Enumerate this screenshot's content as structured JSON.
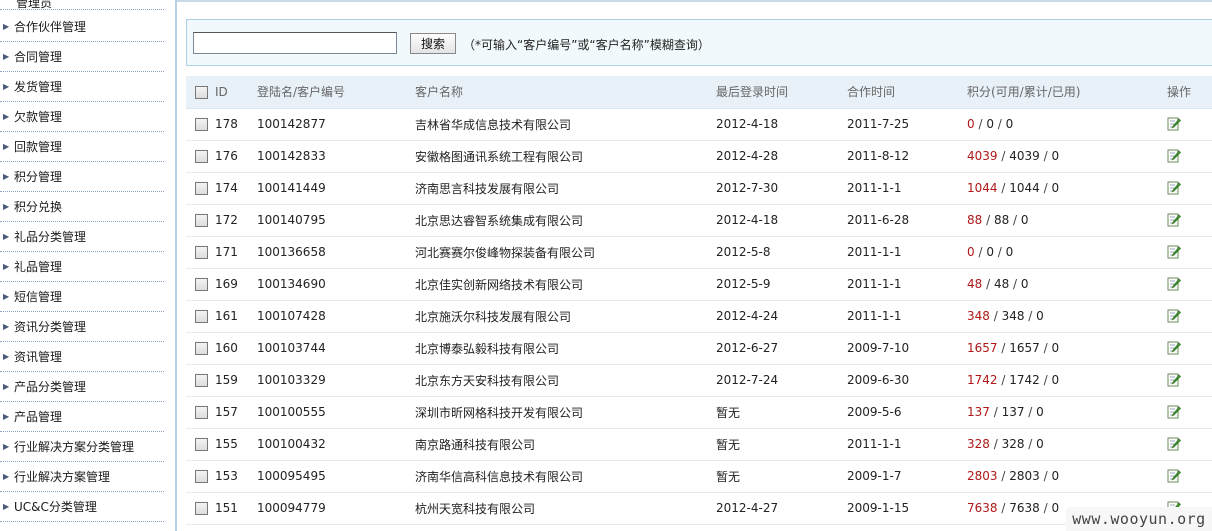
{
  "sidebar": {
    "partial_top_label": "管理员",
    "items": [
      {
        "label": "合作伙伴管理"
      },
      {
        "label": "合同管理"
      },
      {
        "label": "发货管理"
      },
      {
        "label": "欠款管理"
      },
      {
        "label": "回款管理"
      },
      {
        "label": "积分管理"
      },
      {
        "label": "积分兑换"
      },
      {
        "label": "礼品分类管理"
      },
      {
        "label": "礼品管理"
      },
      {
        "label": "短信管理"
      },
      {
        "label": "资讯分类管理"
      },
      {
        "label": "资讯管理"
      },
      {
        "label": "产品分类管理"
      },
      {
        "label": "产品管理"
      },
      {
        "label": "行业解决方案分类管理"
      },
      {
        "label": "行业解决方案管理"
      },
      {
        "label": "UC&C分类管理"
      }
    ]
  },
  "search": {
    "value": "",
    "button_label": "搜索",
    "hint": "（*可输入“客户编号”或“客户名称”模糊查询）"
  },
  "table": {
    "headers": {
      "id": "ID",
      "login": "登陆名/客户编号",
      "name": "客户名称",
      "last_login": "最后登录时间",
      "coop_time": "合作时间",
      "points": "积分(可用/累计/已用)",
      "ops": "操作"
    },
    "rows": [
      {
        "id": "178",
        "login": "100142877",
        "name": "吉林省华成信息技术有限公司",
        "last_login": "2012-4-18",
        "coop_time": "2011-7-25",
        "avail": "0",
        "total": "0",
        "used": "0"
      },
      {
        "id": "176",
        "login": "100142833",
        "name": "安徽格图通讯系统工程有限公司",
        "last_login": "2012-4-28",
        "coop_time": "2011-8-12",
        "avail": "4039",
        "total": "4039",
        "used": "0"
      },
      {
        "id": "174",
        "login": "100141449",
        "name": "济南思言科技发展有限公司",
        "last_login": "2012-7-30",
        "coop_time": "2011-1-1",
        "avail": "1044",
        "total": "1044",
        "used": "0"
      },
      {
        "id": "172",
        "login": "100140795",
        "name": "北京思达睿智系统集成有限公司",
        "last_login": "2012-4-18",
        "coop_time": "2011-6-28",
        "avail": "88",
        "total": "88",
        "used": "0"
      },
      {
        "id": "171",
        "login": "100136658",
        "name": "河北赛赛尔俊峰物探装备有限公司",
        "last_login": "2012-5-8",
        "coop_time": "2011-1-1",
        "avail": "0",
        "total": "0",
        "used": "0"
      },
      {
        "id": "169",
        "login": "100134690",
        "name": "北京佳实创新网络技术有限公司",
        "last_login": "2012-5-9",
        "coop_time": "2011-1-1",
        "avail": "48",
        "total": "48",
        "used": "0"
      },
      {
        "id": "161",
        "login": "100107428",
        "name": "北京施沃尔科技发展有限公司",
        "last_login": "2012-4-24",
        "coop_time": "2011-1-1",
        "avail": "348",
        "total": "348",
        "used": "0"
      },
      {
        "id": "160",
        "login": "100103744",
        "name": "北京博泰弘毅科技有限公司",
        "last_login": "2012-6-27",
        "coop_time": "2009-7-10",
        "avail": "1657",
        "total": "1657",
        "used": "0"
      },
      {
        "id": "159",
        "login": "100103329",
        "name": "北京东方天安科技有限公司",
        "last_login": "2012-7-24",
        "coop_time": "2009-6-30",
        "avail": "1742",
        "total": "1742",
        "used": "0"
      },
      {
        "id": "157",
        "login": "100100555",
        "name": "深圳市昕网格科技开发有限公司",
        "last_login": "暂无",
        "coop_time": "2009-5-6",
        "avail": "137",
        "total": "137",
        "used": "0"
      },
      {
        "id": "155",
        "login": "100100432",
        "name": "南京路通科技有限公司",
        "last_login": "暂无",
        "coop_time": "2011-1-1",
        "avail": "328",
        "total": "328",
        "used": "0"
      },
      {
        "id": "153",
        "login": "100095495",
        "name": "济南华信高科信息技术有限公司",
        "last_login": "暂无",
        "coop_time": "2009-1-7",
        "avail": "2803",
        "total": "2803",
        "used": "0"
      },
      {
        "id": "151",
        "login": "100094779",
        "name": "杭州天宽科技有限公司",
        "last_login": "2012-4-27",
        "coop_time": "2009-1-15",
        "avail": "7638",
        "total": "7638",
        "used": "0"
      }
    ],
    "separator": " / "
  },
  "watermark": {
    "text": "www.wooyun.org"
  },
  "colors": {
    "points_available": "#b01818",
    "header_bg": "#e8f0f8",
    "search_bg": "#f2f9fc"
  },
  "icons": {
    "edit": "edit-icon",
    "sidebar_arrow": "triangle-right-icon"
  }
}
